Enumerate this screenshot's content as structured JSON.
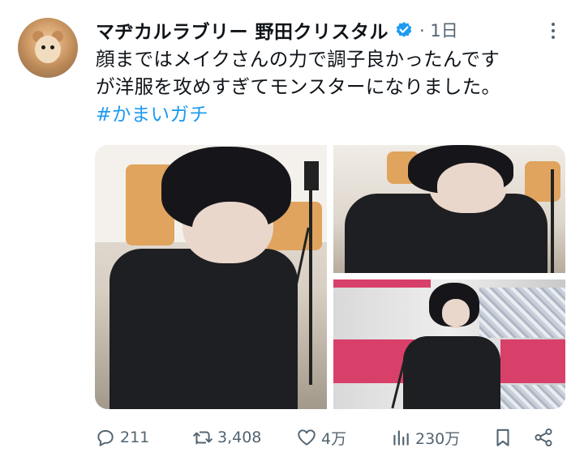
{
  "tweet": {
    "author_name": "マヂカルラブリー 野田クリスタル",
    "time": "· 1日",
    "text_lines": [
      "顔まではメイクさんの力で調子良かったんです",
      "が洋服を攻めすぎてモンスターになりました。"
    ],
    "hashtag": "#かまいガチ"
  },
  "stats": {
    "replies": "211",
    "retweets": "3,408",
    "likes": "4万",
    "views": "230万"
  },
  "icons": {
    "avatar": "hamster-avatar",
    "verified": "verified-badge-icon",
    "more": "more-options-icon",
    "reply": "reply-icon",
    "retweet": "retweet-icon",
    "like": "heart-icon",
    "views": "views-icon",
    "bookmark": "bookmark-icon",
    "share": "share-icon"
  },
  "colors": {
    "accent": "#1d9bf0",
    "muted": "#536471"
  }
}
